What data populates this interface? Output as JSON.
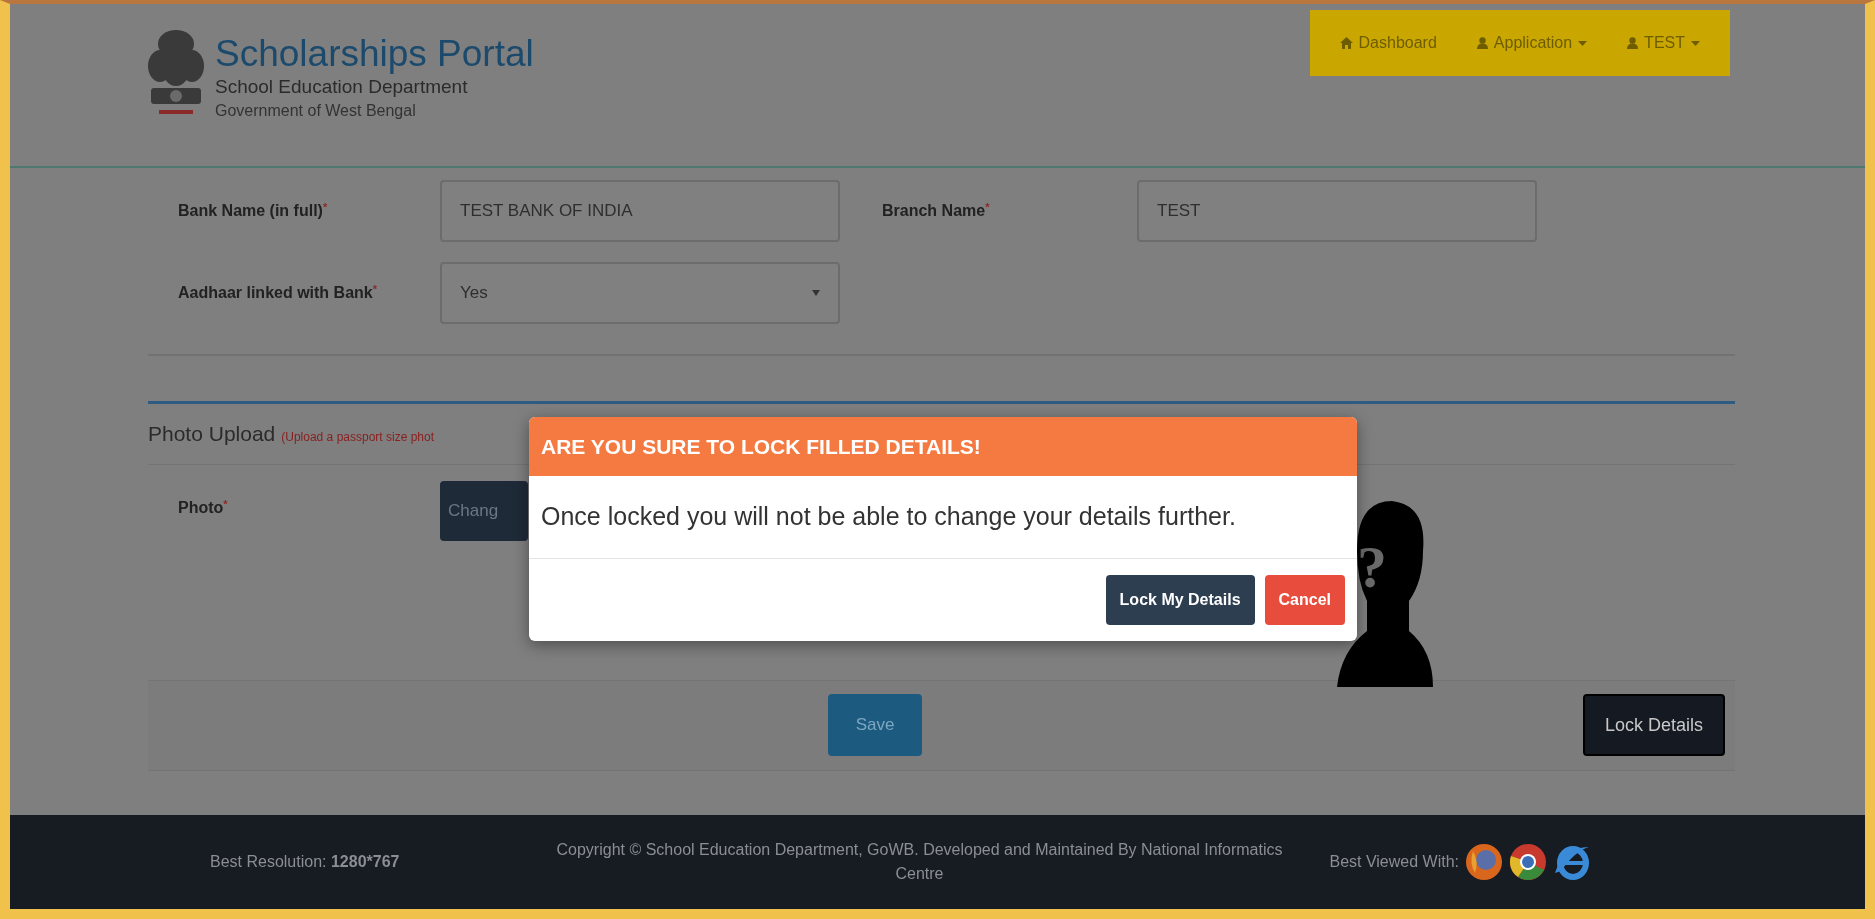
{
  "header": {
    "title": "Scholarships Portal",
    "subtitle": "School Education Department",
    "government": "Government of West Bengal"
  },
  "nav": [
    {
      "label": "Dashboard",
      "kind": "home",
      "dropdown": false
    },
    {
      "label": "Application",
      "kind": "user",
      "dropdown": true
    },
    {
      "label": "TEST",
      "kind": "user",
      "dropdown": true
    }
  ],
  "bank_section": {
    "fields": [
      {
        "label": "Bank Name (in full)",
        "required_mark": "*",
        "kind": "text",
        "value": "TEST BANK OF INDIA"
      },
      {
        "label": "Branch Name",
        "required_mark": "*",
        "kind": "text",
        "value": "TEST"
      },
      {
        "label": "Aadhaar linked with Bank",
        "required_mark": "*",
        "kind": "select",
        "value": "Yes"
      }
    ]
  },
  "photo_section": {
    "title": "Photo Upload",
    "hint": "(Upload a passport size phot",
    "field_label": "Photo",
    "required_mark": "*",
    "button": "Chang",
    "placeholder_mark": "?"
  },
  "actions": {
    "save": "Save",
    "lock": "Lock Details"
  },
  "modal": {
    "title": "ARE YOU SURE TO LOCK FILLED DETAILS!",
    "message": "Once locked you will not be able to change your details further.",
    "buttons": [
      {
        "label": "Lock My Details",
        "kind": "primary"
      },
      {
        "label": "Cancel",
        "kind": "danger"
      }
    ]
  },
  "footer": {
    "resolution": "Best Resolution: **1280*767**",
    "copyright": "Copyright © School Education Department, GoWB. Developed and Maintained By National Informatics Centre",
    "viewed_with": "Best Viewed With:"
  }
}
